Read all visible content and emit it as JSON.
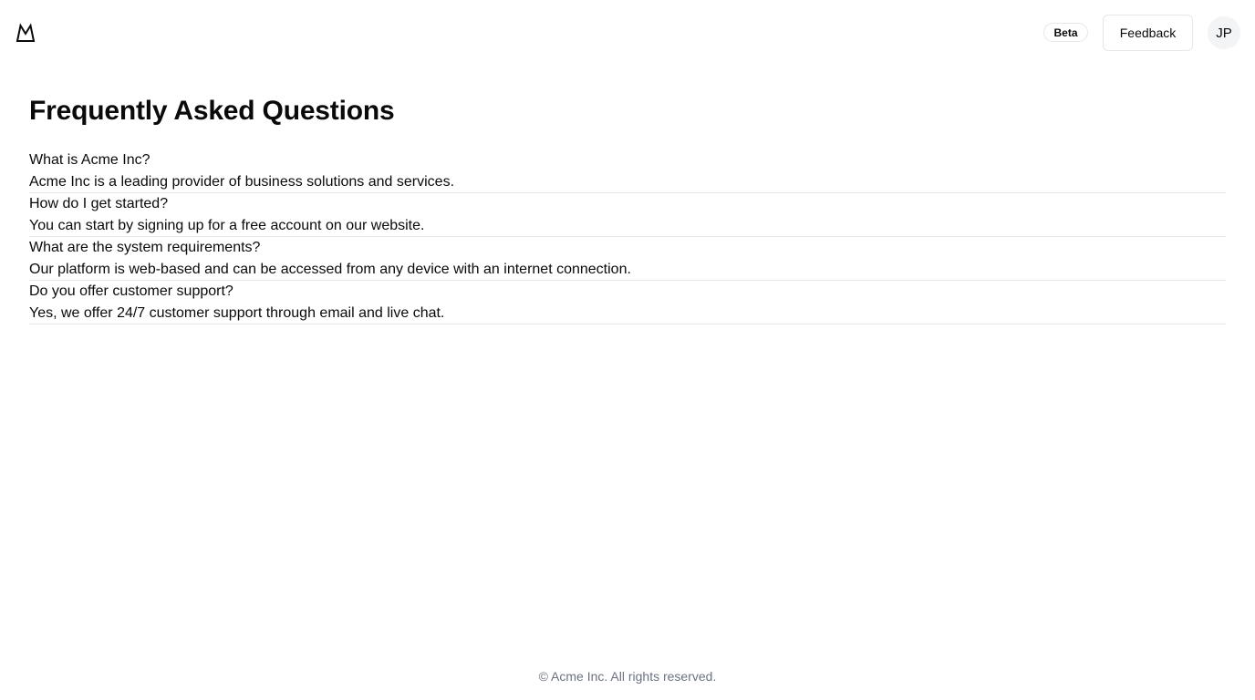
{
  "header": {
    "logo_icon": "mountain-logo-icon",
    "badge_label": "Beta",
    "feedback_label": "Feedback",
    "avatar_initials": "JP"
  },
  "main": {
    "title": "Frequently Asked Questions",
    "faqs": [
      {
        "question": "What is Acme Inc?",
        "answer": "Acme Inc is a leading provider of business solutions and services."
      },
      {
        "question": "How do I get started?",
        "answer": "You can start by signing up for a free account on our website."
      },
      {
        "question": "What are the system requirements?",
        "answer": "Our platform is web-based and can be accessed from any device with an internet connection."
      },
      {
        "question": "Do you offer customer support?",
        "answer": "Yes, we offer 24/7 customer support through email and live chat."
      }
    ]
  },
  "footer": {
    "copyright": "© Acme Inc. All rights reserved."
  },
  "colors": {
    "text": "#0a0a0a",
    "muted": "#6b7280",
    "border": "#e5e7eb",
    "avatar_bg": "#f3f4f6"
  }
}
